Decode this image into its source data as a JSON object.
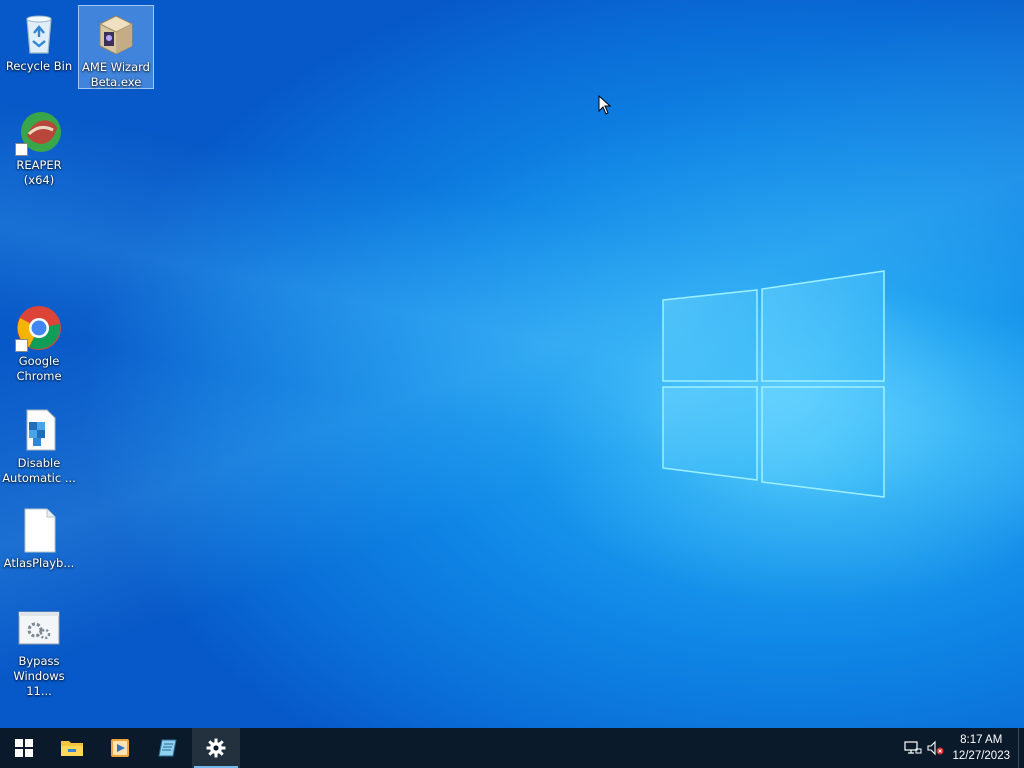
{
  "desktop": {
    "icons": [
      {
        "label": "Recycle Bin",
        "icon": "recycle-bin-icon"
      },
      {
        "label": "AME Wizard Beta.exe",
        "icon": "ame-wizard-icon",
        "selected": true
      },
      {
        "label": "REAPER (x64)",
        "icon": "reaper-icon",
        "shortcut": true
      },
      {
        "label": "Google Chrome",
        "icon": "chrome-icon",
        "shortcut": true
      },
      {
        "label": "Disable Automatic ...",
        "icon": "registry-file-icon"
      },
      {
        "label": "AtlasPlayb...",
        "icon": "blank-file-icon"
      },
      {
        "label": "Bypass Windows 11...",
        "icon": "settings-window-icon"
      }
    ]
  },
  "taskbar": {
    "start": "windows-start-icon",
    "pinned": [
      {
        "name": "file-explorer-icon"
      },
      {
        "name": "media-player-icon"
      },
      {
        "name": "notepad-icon"
      },
      {
        "name": "settings-gear-icon",
        "active": true
      }
    ],
    "tray": {
      "network": "network-icon",
      "volume": "volume-muted-icon",
      "time": "8:17 AM",
      "date": "12/27/2023"
    }
  },
  "colors": {
    "taskbar_bg": "#0b1a2a",
    "desktop_accent": "#0f86e6",
    "active_indicator": "#76b9ed"
  }
}
